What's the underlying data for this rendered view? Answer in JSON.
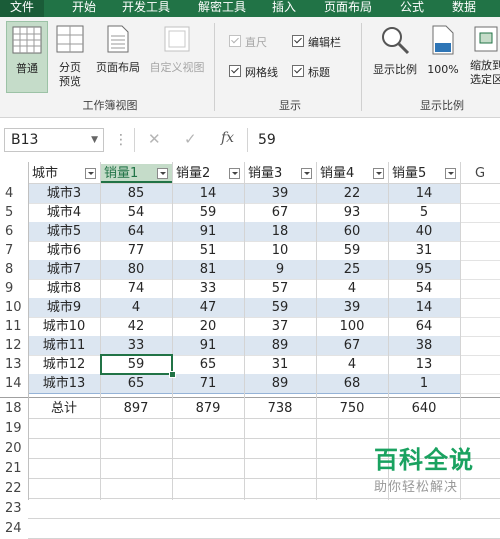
{
  "ribbon_tabs": [
    "文件",
    "开始",
    "开发工具",
    "解密工具",
    "插入",
    "页面布局",
    "公式",
    "数据"
  ],
  "ribbon": {
    "workbook_views": {
      "group_label": "工作簿视图",
      "normal": "普通",
      "page_break_preview": "分页\n预览",
      "page_layout": "页面布局",
      "custom_views": "自定义视图"
    },
    "show": {
      "group_label": "显示",
      "ruler": "直尺",
      "formula_bar": "编辑栏",
      "gridlines": "网格线",
      "headings": "标题"
    },
    "zoom": {
      "group_label": "显示比例",
      "zoom": "显示比例",
      "zoom_100": "100%",
      "zoom_to_selection": "缩放到\n选定区"
    }
  },
  "formula_bar": {
    "name_box": "B13",
    "cancel": "✕",
    "enter": "✓",
    "fx": "fx",
    "value": "59"
  },
  "headers": [
    "城市",
    "销量1",
    "销量2",
    "销量3",
    "销量4",
    "销量5"
  ],
  "column_g": "G",
  "rows": [
    {
      "num": "4",
      "cells": [
        "城市3",
        "85",
        "14",
        "39",
        "22",
        "14"
      ]
    },
    {
      "num": "5",
      "cells": [
        "城市4",
        "54",
        "59",
        "67",
        "93",
        "5"
      ]
    },
    {
      "num": "6",
      "cells": [
        "城市5",
        "64",
        "91",
        "18",
        "60",
        "40"
      ]
    },
    {
      "num": "7",
      "cells": [
        "城市6",
        "77",
        "51",
        "10",
        "59",
        "31"
      ]
    },
    {
      "num": "8",
      "cells": [
        "城市7",
        "80",
        "81",
        "9",
        "25",
        "95"
      ]
    },
    {
      "num": "9",
      "cells": [
        "城市8",
        "74",
        "33",
        "57",
        "4",
        "54"
      ]
    },
    {
      "num": "10",
      "cells": [
        "城市9",
        "4",
        "47",
        "59",
        "39",
        "14"
      ]
    },
    {
      "num": "11",
      "cells": [
        "城市10",
        "42",
        "20",
        "37",
        "100",
        "64"
      ]
    },
    {
      "num": "12",
      "cells": [
        "城市11",
        "33",
        "91",
        "89",
        "67",
        "38"
      ]
    },
    {
      "num": "13",
      "cells": [
        "城市12",
        "59",
        "65",
        "31",
        "4",
        "13"
      ]
    },
    {
      "num": "14",
      "cells": [
        "城市13",
        "65",
        "71",
        "89",
        "68",
        "1"
      ]
    }
  ],
  "total_row": {
    "num": "18",
    "cells": [
      "总计",
      "897",
      "879",
      "738",
      "750",
      "640"
    ]
  },
  "empty_rows": [
    "19",
    "20",
    "21",
    "22",
    "23",
    "24"
  ],
  "watermark": {
    "title": "百科全说",
    "subtitle": "助你轻松解决"
  },
  "colors": {
    "accent": "#217346",
    "band": "#dce6f1",
    "band_line": "#95b3d7"
  }
}
